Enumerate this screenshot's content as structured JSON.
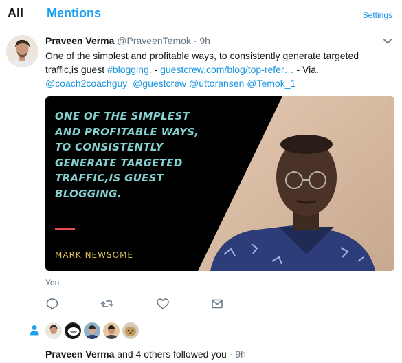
{
  "tabs": {
    "all": "All",
    "mentions": "Mentions",
    "settings": "Settings"
  },
  "tweet": {
    "name": "Praveen Verma",
    "handle": "@PraveenTemok",
    "separator": " · ",
    "time": "9h",
    "text_plain_1": "One of the simplest and profitable ways, to consistently generate targeted traffic,is guest ",
    "hashtag": "#blogging",
    "text_plain_2": ". - ",
    "url": "guestcrew.com/blog/top-refer…",
    "text_plain_3": " - Via.",
    "mentions": [
      "@coach2coachguy",
      "@guestcrew",
      "@uttoransen",
      "@Temok_1"
    ],
    "media": {
      "quote": "ONE OF THE SIMPLEST AND PROFITABLE WAYS, TO CONSISTENTLY GENERATE TARGETED TRAFFIC,IS GUEST BLOGGING.",
      "author": "MARK NEWSOME"
    },
    "social_context": "You",
    "icons": [
      "reply-icon",
      "retweet-icon",
      "like-icon",
      "message-icon",
      "chevron-down-icon"
    ]
  },
  "follow_notification": {
    "name": "Praveen Verma",
    "text": " and 4 others followed you",
    "separator": " · ",
    "time": "9h"
  },
  "colors": {
    "accent": "#1da1f2",
    "link": "#1b95e0",
    "muted": "#657786",
    "quote_teal": "#86cfcf",
    "author_gold": "#d9c060",
    "bar_red": "#e84b55"
  }
}
